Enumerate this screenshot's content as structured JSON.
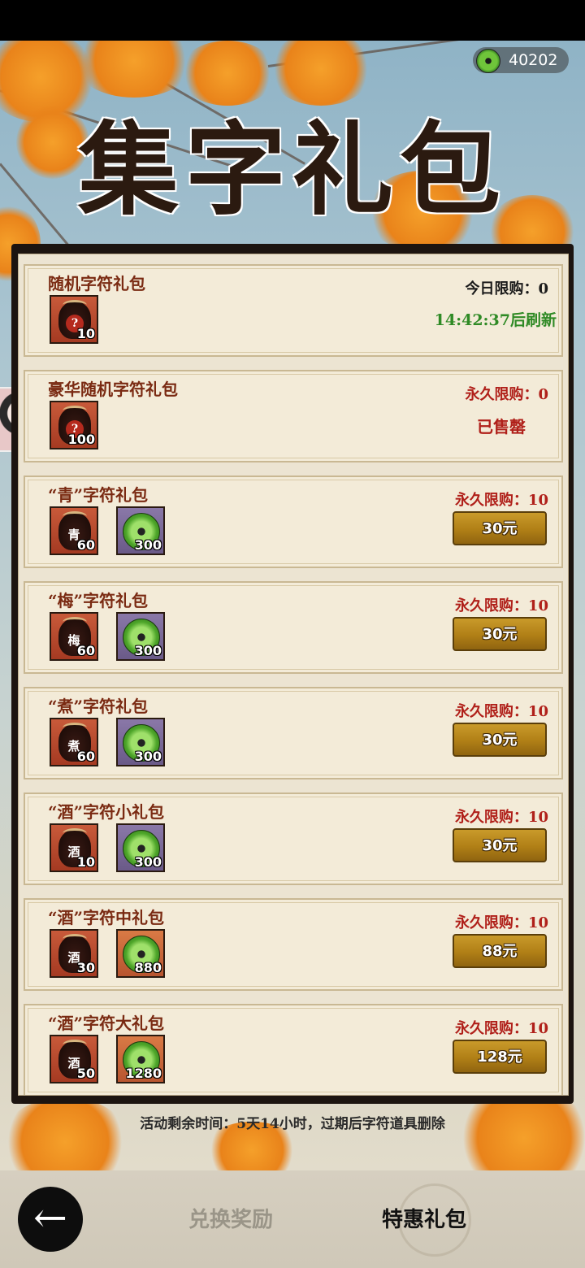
{
  "header": {
    "coin_value": "40202",
    "banner_title": "集字礼包"
  },
  "packs": [
    {
      "title": "随机字符礼包",
      "limit": "今日限购：0",
      "limit_style": "black",
      "status": "14:42:37后刷新",
      "status_type": "refresh",
      "items": [
        {
          "kind": "jar",
          "label": "?",
          "qty": "10"
        }
      ]
    },
    {
      "title": "豪华随机字符礼包",
      "limit": "永久限购：0",
      "limit_style": "red",
      "status": "已售罄",
      "status_type": "sold",
      "items": [
        {
          "kind": "jar",
          "label": "?",
          "qty": "100"
        }
      ]
    },
    {
      "title": "“青”字符礼包",
      "limit": "永久限购：10",
      "limit_style": "red",
      "price": "30元",
      "items": [
        {
          "kind": "jar",
          "char": "青",
          "qty": "60"
        },
        {
          "kind": "coin",
          "qty": "300"
        }
      ]
    },
    {
      "title": "“梅”字符礼包",
      "limit": "永久限购：10",
      "limit_style": "red",
      "price": "30元",
      "items": [
        {
          "kind": "jar",
          "char": "梅",
          "qty": "60"
        },
        {
          "kind": "coin",
          "qty": "300"
        }
      ]
    },
    {
      "title": "“煮”字符礼包",
      "limit": "永久限购：10",
      "limit_style": "red",
      "price": "30元",
      "items": [
        {
          "kind": "jar",
          "char": "煮",
          "qty": "60"
        },
        {
          "kind": "coin",
          "qty": "300"
        }
      ]
    },
    {
      "title": "“酒”字符小礼包",
      "limit": "永久限购：10",
      "limit_style": "red",
      "price": "30元",
      "items": [
        {
          "kind": "jar",
          "char": "酒",
          "qty": "10"
        },
        {
          "kind": "coin",
          "qty": "300"
        }
      ]
    },
    {
      "title": "“酒”字符中礼包",
      "limit": "永久限购：10",
      "limit_style": "red",
      "price": "88元",
      "items": [
        {
          "kind": "jar",
          "char": "酒",
          "qty": "30"
        },
        {
          "kind": "coin",
          "qty": "880",
          "variant": "orange"
        }
      ]
    },
    {
      "title": "“酒”字符大礼包",
      "limit": "永久限购：10",
      "limit_style": "red",
      "price": "128元",
      "items": [
        {
          "kind": "jar",
          "char": "酒",
          "qty": "50"
        },
        {
          "kind": "coin",
          "qty": "1280",
          "variant": "orange"
        }
      ]
    }
  ],
  "footer": {
    "note": "活动剩余时间：5天14小时，过期后字符道具删除"
  },
  "nav": {
    "back_icon": "back-arrow-icon",
    "tab_exchange": "兑换奖励",
    "tab_special": "特惠礼包"
  },
  "colors": {
    "price_button": "#b07f16",
    "limit_red": "#b0201a",
    "refresh_green": "#2f8a25"
  }
}
